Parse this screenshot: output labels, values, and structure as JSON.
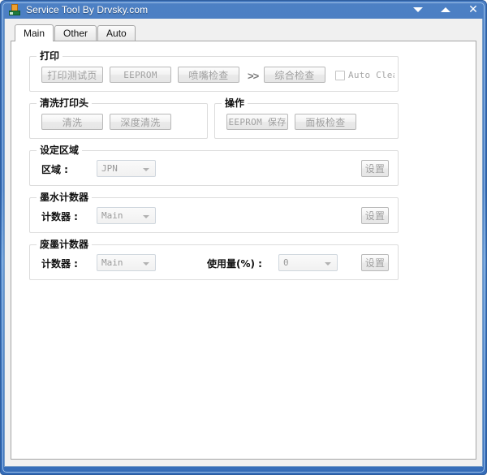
{
  "window": {
    "title": "Service Tool By Drvsky.com",
    "icon": "printer-tool-icon",
    "minimize_label": "▼",
    "maximize_label": "▲",
    "close_label": "✕"
  },
  "tabs": [
    {
      "label": "Main",
      "active": true
    },
    {
      "label": "Other",
      "active": false
    },
    {
      "label": "Auto",
      "active": false
    }
  ],
  "groups": {
    "print": {
      "title": "打印",
      "buttons": [
        {
          "label": "打印测试页",
          "mono": false
        },
        {
          "label": "EEPROM",
          "mono": true
        },
        {
          "label": "喷嘴检查",
          "mono": false
        },
        {
          "label": "综合检查",
          "mono": false
        }
      ],
      "separator": ">>",
      "checkbox": {
        "label": "Auto Cleani:",
        "checked": false
      }
    },
    "cleaning": {
      "title": "清洗打印头",
      "buttons": [
        {
          "label": "清洗",
          "mono": false
        },
        {
          "label": "深度清洗",
          "mono": false
        }
      ]
    },
    "operation": {
      "title": "操作",
      "buttons": [
        {
          "label": "EEPROM 保存",
          "mono": true
        },
        {
          "label": "面板检查",
          "mono": false
        }
      ]
    },
    "region": {
      "title": "设定区域",
      "field_label": "区域 :",
      "combo_value": "JPN",
      "set_button": "设置"
    },
    "ink_counter": {
      "title": "墨水计数器",
      "field_label": "计数器 :",
      "combo_value": "Main",
      "set_button": "设置"
    },
    "waste_counter": {
      "title": "废墨计数器",
      "field_label": "计数器 :",
      "combo_value": "Main",
      "usage_label": "使用量(%) :",
      "usage_value": "0",
      "set_button": "设置"
    }
  },
  "colors": {
    "frame_blue": "#3f74bc",
    "panel_white": "#ffffff",
    "client_gray": "#f0f0f0",
    "disabled_text": "#a0a0a0",
    "group_border": "#dcdcdc"
  }
}
